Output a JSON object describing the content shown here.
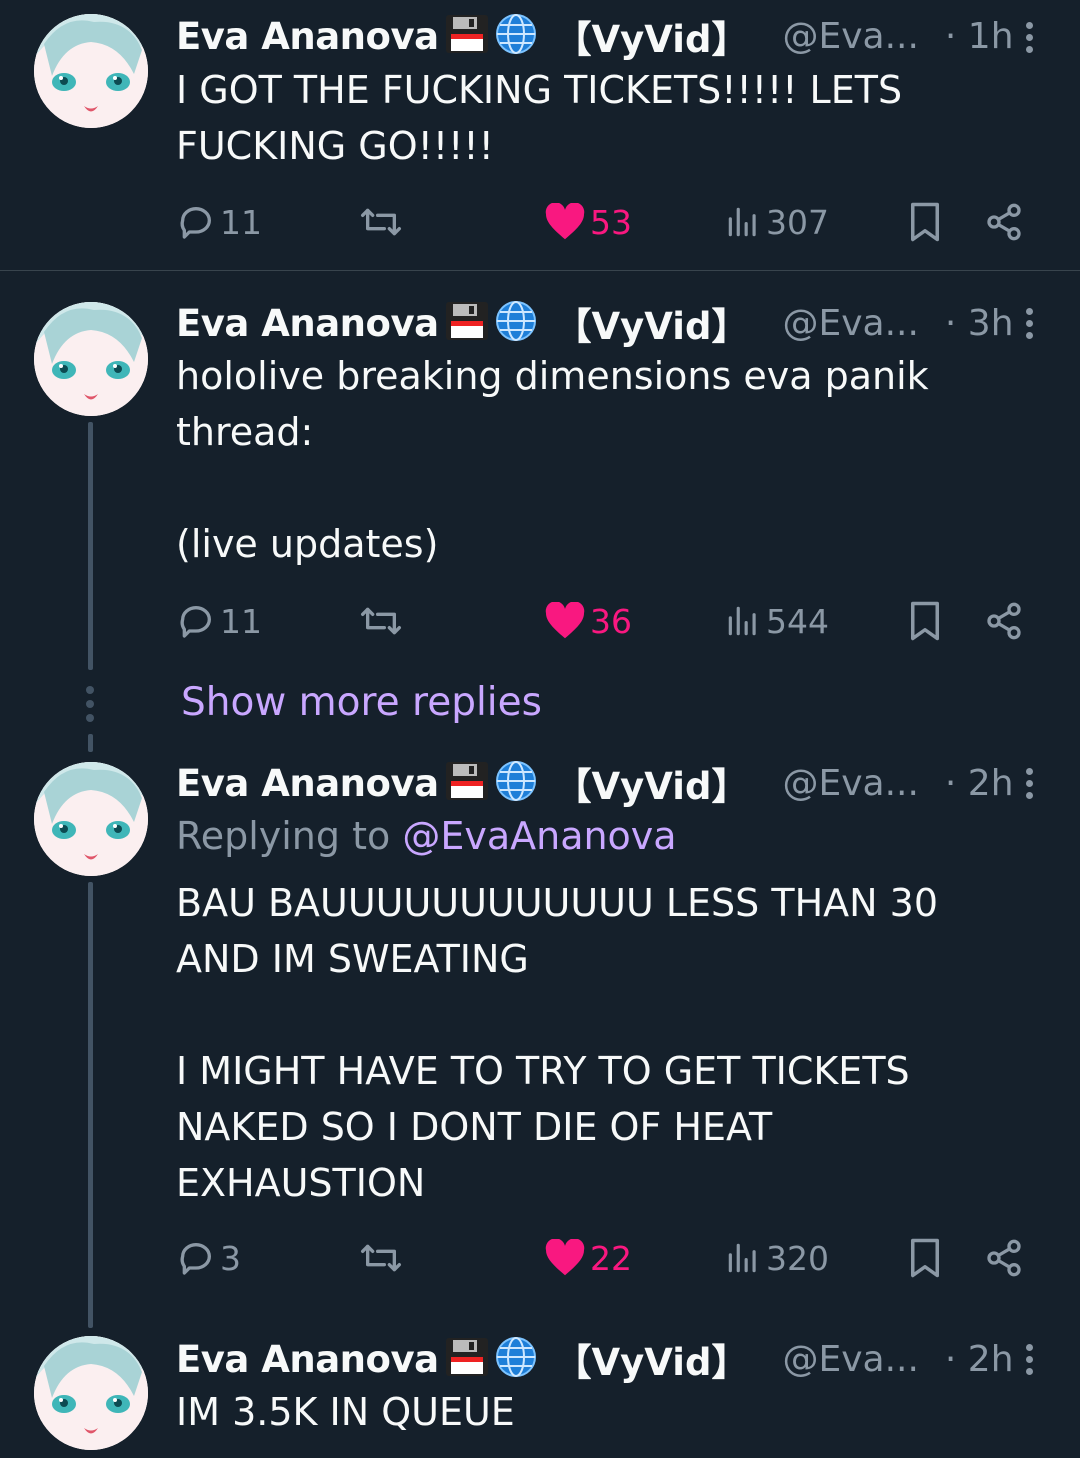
{
  "colors": {
    "background": "#15202b",
    "text": "#f7f9f9",
    "muted": "#8b98a5",
    "like": "#f91880",
    "accent": "#c9a7ff",
    "divider": "#38444d"
  },
  "tweets": [
    {
      "name": "Eva Ananova",
      "emojis": [
        "floppy-disk-icon",
        "globe-icon"
      ],
      "tag": "【VyVid】",
      "handle": "@Eva...",
      "time": "· 1h",
      "replying_prefix": "",
      "replying_to": "",
      "text": "I GOT THE FUCKING TICKETS!!!!! LETS\nFUCKING GO!!!!!",
      "replies": "11",
      "likes": "53",
      "views": "307"
    },
    {
      "name": "Eva Ananova",
      "emojis": [
        "floppy-disk-icon",
        "globe-icon"
      ],
      "tag": "【VyVid】",
      "handle": "@Eva...",
      "time": "· 3h",
      "replying_prefix": "",
      "replying_to": "",
      "text": "hololive breaking dimensions eva panik\nthread:\n\n(live updates)",
      "replies": "11",
      "likes": "36",
      "views": "544"
    },
    {
      "name": "Eva Ananova",
      "emojis": [
        "floppy-disk-icon",
        "globe-icon"
      ],
      "tag": "【VyVid】",
      "handle": "@Eva...",
      "time": "· 2h",
      "replying_prefix": "Replying to",
      "replying_to": "@EvaAnanova",
      "text": "BAU BAUUUUUUUUUUUU LESS THAN 30\nAND IM SWEATING\n\nI MIGHT HAVE TO TRY TO GET TICKETS\nNAKED SO I DONT DIE OF HEAT\nEXHAUSTION",
      "replies": "3",
      "likes": "22",
      "views": "320"
    },
    {
      "name": "Eva Ananova",
      "emojis": [
        "floppy-disk-icon",
        "globe-icon"
      ],
      "tag": "【VyVid】",
      "handle": "@Eva...",
      "time": "· 2h",
      "replying_prefix": "",
      "replying_to": "",
      "text": "IM 3.5K IN QUEUE"
    }
  ],
  "show_more_replies": "Show more replies"
}
